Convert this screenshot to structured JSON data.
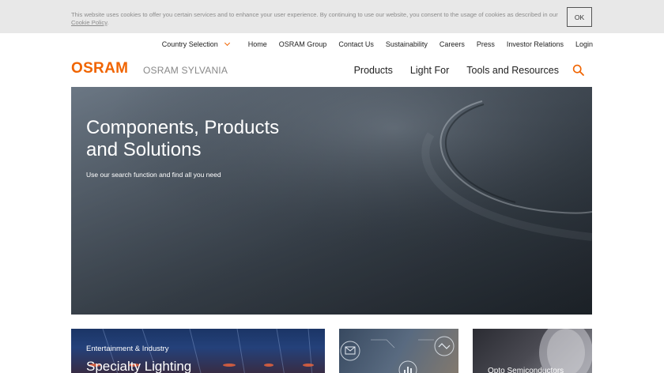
{
  "cookie": {
    "text": "This website uses cookies to offer you certain services and to enhance your user experience. By continuing to use our website, you consent to the usage of cookies as described in our",
    "link": "Cookie Policy",
    "ok_label": "OK"
  },
  "utility_nav": {
    "country": "Country Selection",
    "items": [
      "Home",
      "OSRAM Group",
      "Contact Us",
      "Sustainability",
      "Careers",
      "Press",
      "Investor Relations",
      "Login"
    ]
  },
  "header": {
    "logo": "OSRAM",
    "sub_brand": "OSRAM SYLVANIA",
    "nav": [
      "Products",
      "Light For",
      "Tools and Resources"
    ]
  },
  "hero": {
    "title_line1": "Components, Products",
    "title_line2": "and Solutions",
    "subtitle": "Use our search function and find all you need"
  },
  "tiles": [
    {
      "kicker": "Entertainment & Industry",
      "title": "Specialty Lighting"
    },
    {
      "kicker": "",
      "title": ""
    },
    {
      "kicker": "",
      "title": "Opto Semiconductors"
    }
  ],
  "colors": {
    "accent": "#f06400",
    "cookie_bg": "#e8e8e8"
  },
  "icons": {
    "search": "search-icon",
    "chevron": "chevron-down-icon"
  }
}
